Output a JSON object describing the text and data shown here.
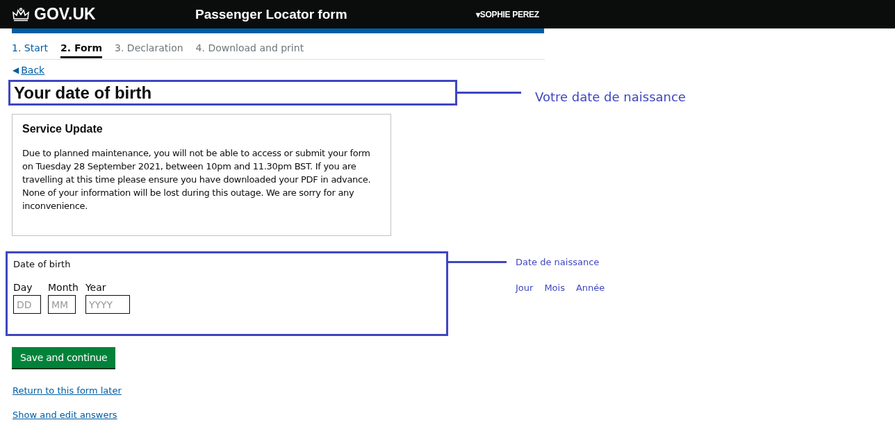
{
  "header": {
    "logo": "GOV.UK",
    "title": "Passenger Locator form",
    "user": "SOPHIE PEREZ",
    "user_caret": "▾"
  },
  "steps": [
    {
      "label": "1. Start",
      "selected": false,
      "completed": true
    },
    {
      "label": "2. Form",
      "selected": true,
      "completed": false
    },
    {
      "label": "3. Declaration",
      "selected": false,
      "completed": false
    },
    {
      "label": "4. Download and print",
      "selected": false,
      "completed": false
    }
  ],
  "back": {
    "arrow": "◀",
    "label": "Back"
  },
  "heading": "Your date of birth",
  "heading_annotation": "Votre date de naissance",
  "notice": {
    "title": "Service Update",
    "body": "Due to planned maintenance, you will not be able to access or submit your form on Tuesday 28 September 2021, between 10pm and 11.30pm BST. If you are travelling at this time please ensure you have downloaded your PDF in advance. None of your information will be lost during this outage. We are sorry for any inconvenience."
  },
  "date_of_birth": {
    "legend": "Date of birth",
    "fields": [
      {
        "kind": "day",
        "label": "Day",
        "placeholder": "DD"
      },
      {
        "kind": "month",
        "label": "Month",
        "placeholder": "MM"
      },
      {
        "kind": "year",
        "label": "Year",
        "placeholder": "YYYY"
      }
    ]
  },
  "date_annotation": {
    "legend": "Date de naissance",
    "fields": [
      "Jour",
      "Mois",
      "Année"
    ]
  },
  "submit": "Save and continue",
  "links": [
    "Return to this form later",
    "Show and edit answers"
  ]
}
